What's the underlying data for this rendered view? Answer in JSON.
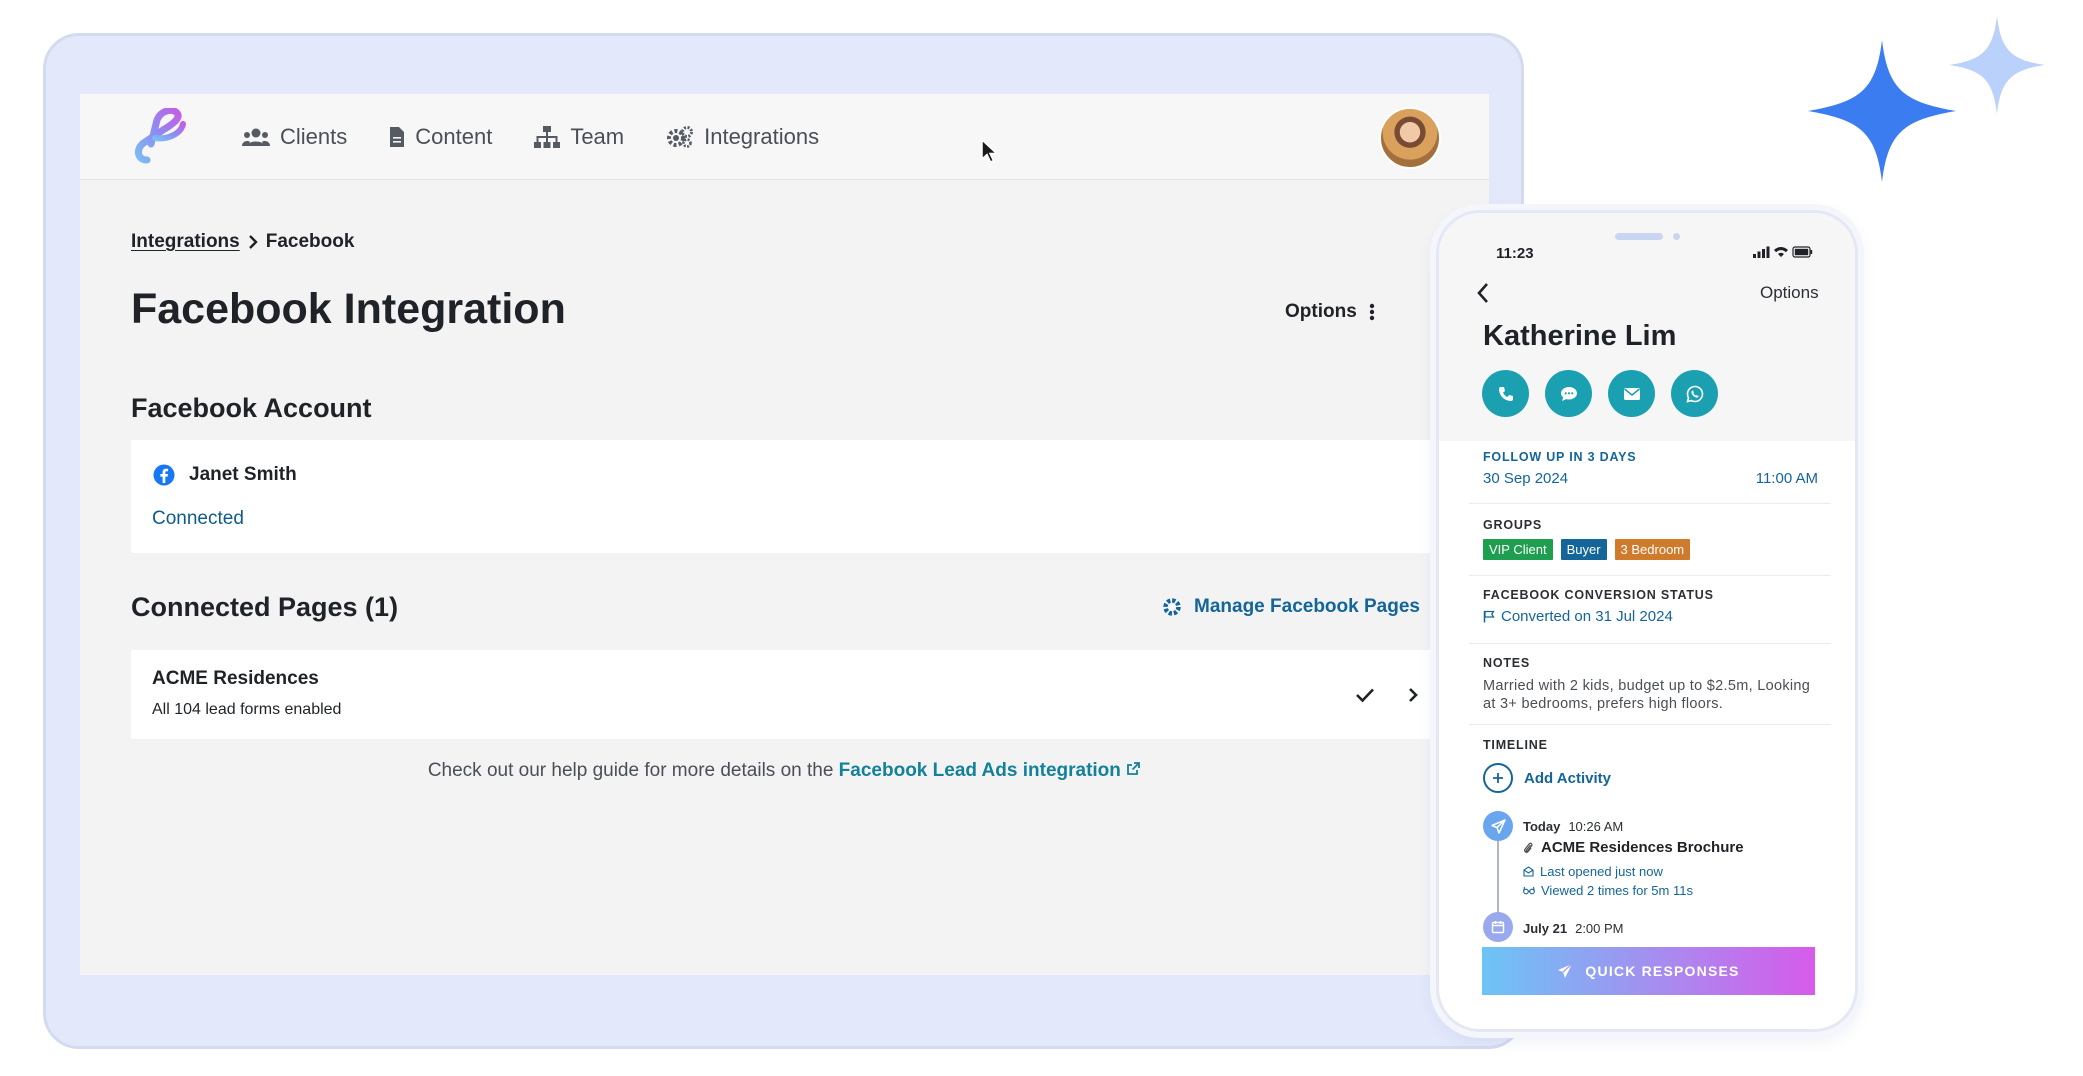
{
  "nav": {
    "items": [
      {
        "label": "Clients",
        "icon": "users-icon"
      },
      {
        "label": "Content",
        "icon": "document-icon"
      },
      {
        "label": "Team",
        "icon": "sitemap-icon"
      },
      {
        "label": "Integrations",
        "icon": "gears-icon"
      }
    ]
  },
  "breadcrumb": {
    "parent": "Integrations",
    "current": "Facebook"
  },
  "page": {
    "title": "Facebook Integration",
    "options_label": "Options"
  },
  "account": {
    "section_title": "Facebook Account",
    "name": "Janet Smith",
    "status": "Connected"
  },
  "pages": {
    "section_title": "Connected Pages (1)",
    "manage_label": "Manage Facebook Pages",
    "items": [
      {
        "name": "ACME Residences",
        "detail": "All 104 lead forms enabled"
      }
    ]
  },
  "help": {
    "text": "Check out our help guide for more details on the",
    "link": "Facebook Lead Ads integration"
  },
  "phone": {
    "time": "11:23",
    "options_label": "Options",
    "contact_name": "Katherine Lim",
    "follow_up": {
      "label": "FOLLOW UP IN 3 DAYS",
      "date": "30 Sep 2024",
      "time": "11:00 AM"
    },
    "groups": {
      "label": "GROUPS",
      "chips": [
        {
          "label": "VIP Client",
          "color": "#1e9e4f"
        },
        {
          "label": "Buyer",
          "color": "#14659a"
        },
        {
          "label": "3 Bedroom",
          "color": "#d07a2c"
        }
      ]
    },
    "conversion": {
      "label": "FACEBOOK CONVERSION STATUS",
      "value": "Converted on 31 Jul 2024"
    },
    "notes": {
      "label": "NOTES",
      "text": "Married with 2 kids, budget up to $2.5m, Looking at 3+ bedrooms, prefers high floors."
    },
    "timeline": {
      "label": "TIMELINE",
      "add_label": "Add Activity",
      "entries": [
        {
          "day": "Today",
          "time": "10:26 AM",
          "title": "ACME Residences Brochure",
          "opened": "Last opened just now",
          "viewed": "Viewed 2 times for 5m 11s"
        },
        {
          "day": "July 21",
          "time": "2:00 PM"
        }
      ]
    },
    "quick_label": "QUICK RESPONSES"
  },
  "colors": {
    "accent": "#14659a",
    "teal": "#1aa0b0",
    "sparkle_dark": "#3b7df0",
    "sparkle_light": "#b9d1fb",
    "frame": "#e3e8fb"
  }
}
